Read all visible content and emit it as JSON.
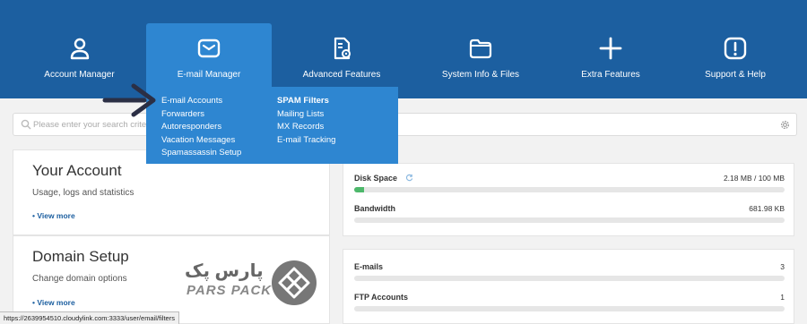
{
  "nav": {
    "items": [
      {
        "label": "Account Manager",
        "icon": "user-icon"
      },
      {
        "label": "E-mail Manager",
        "icon": "envelope-icon"
      },
      {
        "label": "Advanced Features",
        "icon": "settings-document-icon"
      },
      {
        "label": "System Info & Files",
        "icon": "folder-icon"
      },
      {
        "label": "Extra Features",
        "icon": "plus-icon"
      },
      {
        "label": "Support & Help",
        "icon": "alert-icon"
      }
    ]
  },
  "email_menu": {
    "col1": [
      "E-mail Accounts",
      "Forwarders",
      "Autoresponders",
      "Vacation Messages",
      "Spamassassin Setup"
    ],
    "col2": [
      "SPAM Filters",
      "Mailing Lists",
      "MX Records",
      "E-mail Tracking"
    ]
  },
  "search": {
    "placeholder": "Please enter your search criteria"
  },
  "your_account": {
    "title": "Your Account",
    "subtitle": "Usage, logs and statistics",
    "more": "• View more"
  },
  "domain_setup": {
    "title": "Domain Setup",
    "subtitle": "Change domain options",
    "more": "• View more"
  },
  "usage": {
    "disk": {
      "label": "Disk Space",
      "value": "2.18 MB / 100 MB",
      "fraction": 0.022
    },
    "bandwidth": {
      "label": "Bandwidth",
      "value": "681.98 KB",
      "fraction": 0
    }
  },
  "counts": {
    "emails": {
      "label": "E-mails",
      "value": "3",
      "fraction": 0
    },
    "ftp": {
      "label": "FTP Accounts",
      "value": "1",
      "fraction": 0
    }
  },
  "logo": {
    "fa": "پارس پک",
    "en": "PARS PACK"
  },
  "status_url": "https://2639954510.cloudylink.com:3333/user/email/filters",
  "colors": {
    "nav_bg": "#1c5fa0",
    "active_bg": "#2e86d1",
    "bar_fill": "#4db86b"
  }
}
